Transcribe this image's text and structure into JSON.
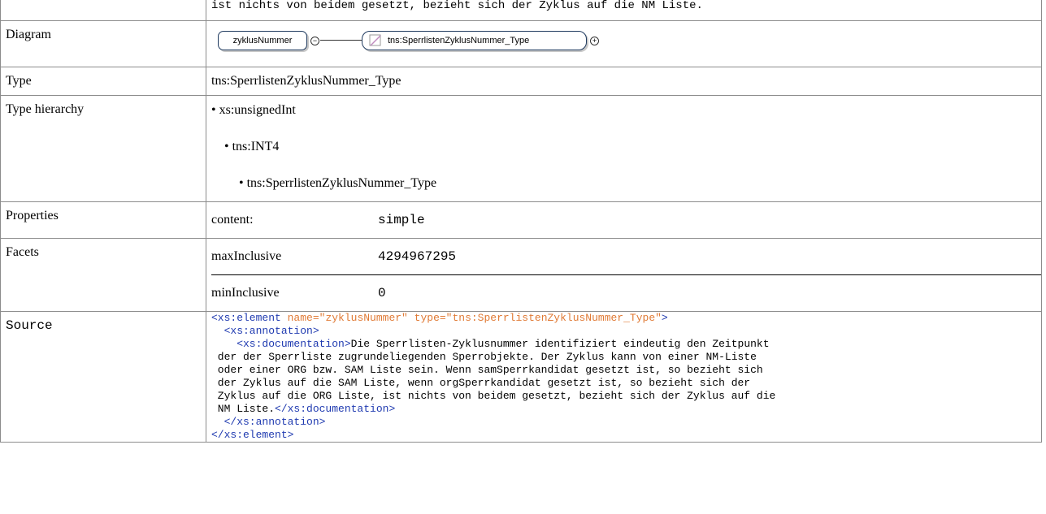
{
  "top_text": "ist nichts von beidem gesetzt, bezieht sich der Zyklus auf die NM Liste.",
  "rows": {
    "diagram": {
      "label": "Diagram",
      "element": "zyklusNummer",
      "type": "tns:SperrlistenZyklusNummer_Type",
      "icons": [
        "collapse-circle-icon",
        "simple-type-icon",
        "expand-circle-icon"
      ]
    },
    "type": {
      "label": "Type",
      "value": "tns:SperrlistenZyklusNummer_Type"
    },
    "hierarchy": {
      "label": "Type hierarchy",
      "items": [
        "xs:unsignedInt",
        "tns:INT4",
        "tns:SperrlistenZyklusNummer_Type"
      ]
    },
    "properties": {
      "label": "Properties",
      "key": "content:",
      "value": "simple"
    },
    "facets": {
      "label": "Facets",
      "items": [
        {
          "key": "maxInclusive",
          "value": "4294967295"
        },
        {
          "key": "minInclusive",
          "value": "0"
        }
      ]
    },
    "source": {
      "label": "Source",
      "l1_tag": "<xs:element",
      "l1_attr1": " name=",
      "l1_val1": "\"zyklusNummer\"",
      "l1_attr2": " type=",
      "l1_val2": "\"tns:SperrlistenZyklusNummer_Type\"",
      "l1_end": ">",
      "l2": "  <xs:annotation>",
      "l3_tag": "    <xs:documentation>",
      "l3_text": "Die Sperrlisten-Zyklusnummer identifiziert eindeutig den Zeitpunkt",
      "l4": " der der Sperrliste zugrundeliegenden Sperrobjekte. Der Zyklus kann von einer NM-Liste",
      "l5": " oder einer ORG bzw. SAM Liste sein. Wenn samSperrkandidat gesetzt ist, so bezieht sich",
      "l6": " der Zyklus auf die SAM Liste, wenn orgSperrkandidat gesetzt ist, so bezieht sich der",
      "l7": " Zyklus auf die ORG Liste, ist nichts von beidem gesetzt, bezieht sich der Zyklus auf die",
      "l8_text": " NM Liste.",
      "l8_tag": "</xs:documentation>",
      "l9": "  </xs:annotation>",
      "l10": "</xs:element>"
    }
  }
}
